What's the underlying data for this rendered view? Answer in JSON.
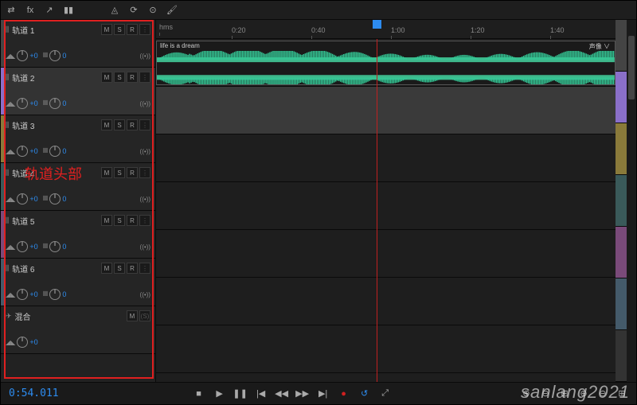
{
  "toolbar": {
    "left_icons": [
      "⇄",
      "fx",
      "↗",
      "▮▮"
    ],
    "right_icons": [
      "◬",
      "⟳",
      "⊙",
      "🖌"
    ]
  },
  "ruler": {
    "unit": "hms",
    "ticks": [
      "0:20",
      "0:40",
      "1:00",
      "1:20",
      "1:40"
    ]
  },
  "tracks": [
    {
      "name": "轨道 1",
      "msr": [
        "M",
        "S",
        "R"
      ],
      "vol": "+0",
      "pan": "0",
      "color": "cs1",
      "selected": false
    },
    {
      "name": "轨道 2",
      "msr": [
        "M",
        "S",
        "R"
      ],
      "vol": "+0",
      "pan": "0",
      "color": "cs2",
      "selected": true
    },
    {
      "name": "轨道 3",
      "msr": [
        "M",
        "S",
        "R"
      ],
      "vol": "+0",
      "pan": "0",
      "color": "cs3",
      "selected": false
    },
    {
      "name": "轨道 4",
      "msr": [
        "M",
        "S",
        "R"
      ],
      "vol": "+0",
      "pan": "0",
      "color": "cs4",
      "selected": false
    },
    {
      "name": "轨道 5",
      "msr": [
        "M",
        "S",
        "R"
      ],
      "vol": "+0",
      "pan": "0",
      "color": "cs5",
      "selected": false
    },
    {
      "name": "轨道 6",
      "msr": [
        "M",
        "S",
        "R"
      ],
      "vol": "+0",
      "pan": "0",
      "color": "cs6",
      "selected": false
    }
  ],
  "mix_track": {
    "name": "混合",
    "msr": [
      "M",
      "(S)"
    ],
    "vol": "+0"
  },
  "annotation": "轨道头部",
  "clip": {
    "label": "life is a dream",
    "right_label": "声像 ∨"
  },
  "side_colors": [
    "#444",
    "#8a6fc9",
    "#8a7a3a",
    "#3a5a5a",
    "#7a4a7a",
    "#445a6a",
    "#333"
  ],
  "playhead_pct": 48,
  "bottom": {
    "timecode": "0:54.011",
    "transport": [
      "■",
      "▶",
      "❚❚",
      "|◀",
      "◀◀",
      "▶▶",
      "▶|",
      "●",
      "↺",
      "⤢"
    ],
    "zoom": [
      "⊕",
      "⊖",
      "⊞",
      "⊕",
      "⊖",
      "⊞"
    ]
  },
  "watermark": "sanlang2021"
}
